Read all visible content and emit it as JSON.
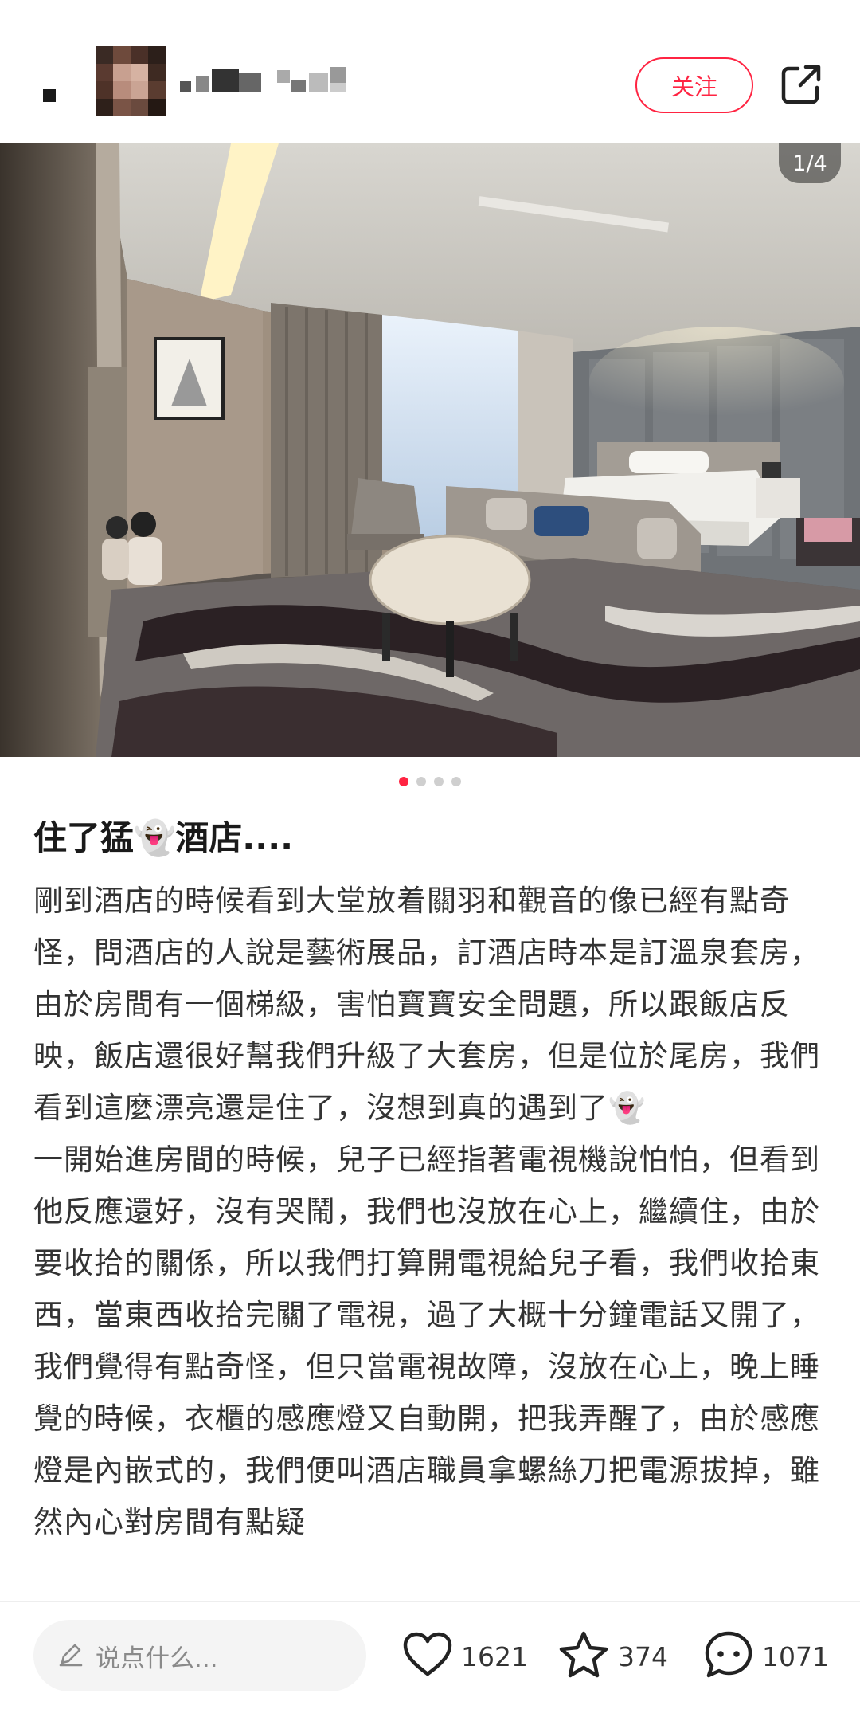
{
  "header": {
    "follow_label": "关注",
    "icons": {
      "share": "share-external-icon"
    }
  },
  "photo": {
    "counter": "1/4",
    "total": 4,
    "current": 1
  },
  "post": {
    "title": "住了猛👻酒店....",
    "body": "剛到酒店的時候看到大堂放着關羽和觀音的像已經有點奇怪，問酒店的人說是藝術展品，訂酒店時本是訂溫泉套房，由於房間有一個梯級，害怕寶寶安全問題，所以跟飯店反映，飯店還很好幫我們升級了大套房，但是位於尾房，我們看到這麼漂亮還是住了，沒想到真的遇到了👻\n一開始進房間的時候，兒子已經指著電視機說怕怕，但看到他反應還好，沒有哭鬧，我們也沒放在心上，繼續住，由於要收拾的關係，所以我們打算開電視給兒子看，我們收拾東西，當東西收拾完關了電視，過了大概十分鐘電話又開了，我們覺得有點奇怪，但只當電視故障，沒放在心上，晚上睡覺的時候，衣櫃的感應燈又自動開，把我弄醒了，由於感應燈是內嵌式的，我們便叫酒店職員拿螺絲刀把電源拔掉，雖然內心對房間有點疑"
  },
  "bottom_bar": {
    "comment_placeholder": "说点什么...",
    "likes": "1621",
    "favorites": "374",
    "comments": "1071",
    "icons": {
      "edit": "pencil-icon",
      "like": "heart-icon",
      "favorite": "star-icon",
      "comment": "chat-bubble-icon"
    }
  },
  "colors": {
    "accent": "#ff2442",
    "text": "#333333",
    "muted": "#8a8a8a"
  }
}
